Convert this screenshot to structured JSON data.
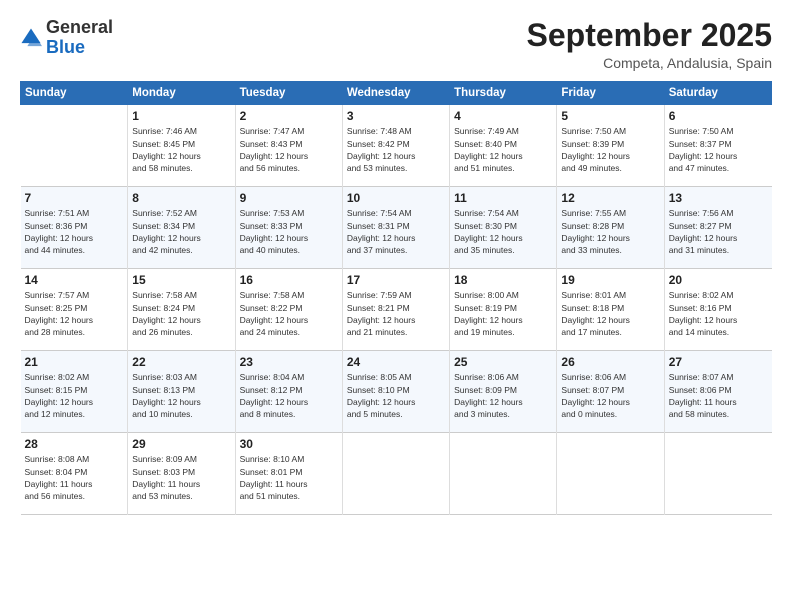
{
  "logo": {
    "general": "General",
    "blue": "Blue"
  },
  "title": "September 2025",
  "subtitle": "Competa, Andalusia, Spain",
  "headers": [
    "Sunday",
    "Monday",
    "Tuesday",
    "Wednesday",
    "Thursday",
    "Friday",
    "Saturday"
  ],
  "weeks": [
    [
      {
        "day": "",
        "content": ""
      },
      {
        "day": "1",
        "content": "Sunrise: 7:46 AM\nSunset: 8:45 PM\nDaylight: 12 hours\nand 58 minutes."
      },
      {
        "day": "2",
        "content": "Sunrise: 7:47 AM\nSunset: 8:43 PM\nDaylight: 12 hours\nand 56 minutes."
      },
      {
        "day": "3",
        "content": "Sunrise: 7:48 AM\nSunset: 8:42 PM\nDaylight: 12 hours\nand 53 minutes."
      },
      {
        "day": "4",
        "content": "Sunrise: 7:49 AM\nSunset: 8:40 PM\nDaylight: 12 hours\nand 51 minutes."
      },
      {
        "day": "5",
        "content": "Sunrise: 7:50 AM\nSunset: 8:39 PM\nDaylight: 12 hours\nand 49 minutes."
      },
      {
        "day": "6",
        "content": "Sunrise: 7:50 AM\nSunset: 8:37 PM\nDaylight: 12 hours\nand 47 minutes."
      }
    ],
    [
      {
        "day": "7",
        "content": "Sunrise: 7:51 AM\nSunset: 8:36 PM\nDaylight: 12 hours\nand 44 minutes."
      },
      {
        "day": "8",
        "content": "Sunrise: 7:52 AM\nSunset: 8:34 PM\nDaylight: 12 hours\nand 42 minutes."
      },
      {
        "day": "9",
        "content": "Sunrise: 7:53 AM\nSunset: 8:33 PM\nDaylight: 12 hours\nand 40 minutes."
      },
      {
        "day": "10",
        "content": "Sunrise: 7:54 AM\nSunset: 8:31 PM\nDaylight: 12 hours\nand 37 minutes."
      },
      {
        "day": "11",
        "content": "Sunrise: 7:54 AM\nSunset: 8:30 PM\nDaylight: 12 hours\nand 35 minutes."
      },
      {
        "day": "12",
        "content": "Sunrise: 7:55 AM\nSunset: 8:28 PM\nDaylight: 12 hours\nand 33 minutes."
      },
      {
        "day": "13",
        "content": "Sunrise: 7:56 AM\nSunset: 8:27 PM\nDaylight: 12 hours\nand 31 minutes."
      }
    ],
    [
      {
        "day": "14",
        "content": "Sunrise: 7:57 AM\nSunset: 8:25 PM\nDaylight: 12 hours\nand 28 minutes."
      },
      {
        "day": "15",
        "content": "Sunrise: 7:58 AM\nSunset: 8:24 PM\nDaylight: 12 hours\nand 26 minutes."
      },
      {
        "day": "16",
        "content": "Sunrise: 7:58 AM\nSunset: 8:22 PM\nDaylight: 12 hours\nand 24 minutes."
      },
      {
        "day": "17",
        "content": "Sunrise: 7:59 AM\nSunset: 8:21 PM\nDaylight: 12 hours\nand 21 minutes."
      },
      {
        "day": "18",
        "content": "Sunrise: 8:00 AM\nSunset: 8:19 PM\nDaylight: 12 hours\nand 19 minutes."
      },
      {
        "day": "19",
        "content": "Sunrise: 8:01 AM\nSunset: 8:18 PM\nDaylight: 12 hours\nand 17 minutes."
      },
      {
        "day": "20",
        "content": "Sunrise: 8:02 AM\nSunset: 8:16 PM\nDaylight: 12 hours\nand 14 minutes."
      }
    ],
    [
      {
        "day": "21",
        "content": "Sunrise: 8:02 AM\nSunset: 8:15 PM\nDaylight: 12 hours\nand 12 minutes."
      },
      {
        "day": "22",
        "content": "Sunrise: 8:03 AM\nSunset: 8:13 PM\nDaylight: 12 hours\nand 10 minutes."
      },
      {
        "day": "23",
        "content": "Sunrise: 8:04 AM\nSunset: 8:12 PM\nDaylight: 12 hours\nand 8 minutes."
      },
      {
        "day": "24",
        "content": "Sunrise: 8:05 AM\nSunset: 8:10 PM\nDaylight: 12 hours\nand 5 minutes."
      },
      {
        "day": "25",
        "content": "Sunrise: 8:06 AM\nSunset: 8:09 PM\nDaylight: 12 hours\nand 3 minutes."
      },
      {
        "day": "26",
        "content": "Sunrise: 8:06 AM\nSunset: 8:07 PM\nDaylight: 12 hours\nand 0 minutes."
      },
      {
        "day": "27",
        "content": "Sunrise: 8:07 AM\nSunset: 8:06 PM\nDaylight: 11 hours\nand 58 minutes."
      }
    ],
    [
      {
        "day": "28",
        "content": "Sunrise: 8:08 AM\nSunset: 8:04 PM\nDaylight: 11 hours\nand 56 minutes."
      },
      {
        "day": "29",
        "content": "Sunrise: 8:09 AM\nSunset: 8:03 PM\nDaylight: 11 hours\nand 53 minutes."
      },
      {
        "day": "30",
        "content": "Sunrise: 8:10 AM\nSunset: 8:01 PM\nDaylight: 11 hours\nand 51 minutes."
      },
      {
        "day": "",
        "content": ""
      },
      {
        "day": "",
        "content": ""
      },
      {
        "day": "",
        "content": ""
      },
      {
        "day": "",
        "content": ""
      }
    ]
  ]
}
